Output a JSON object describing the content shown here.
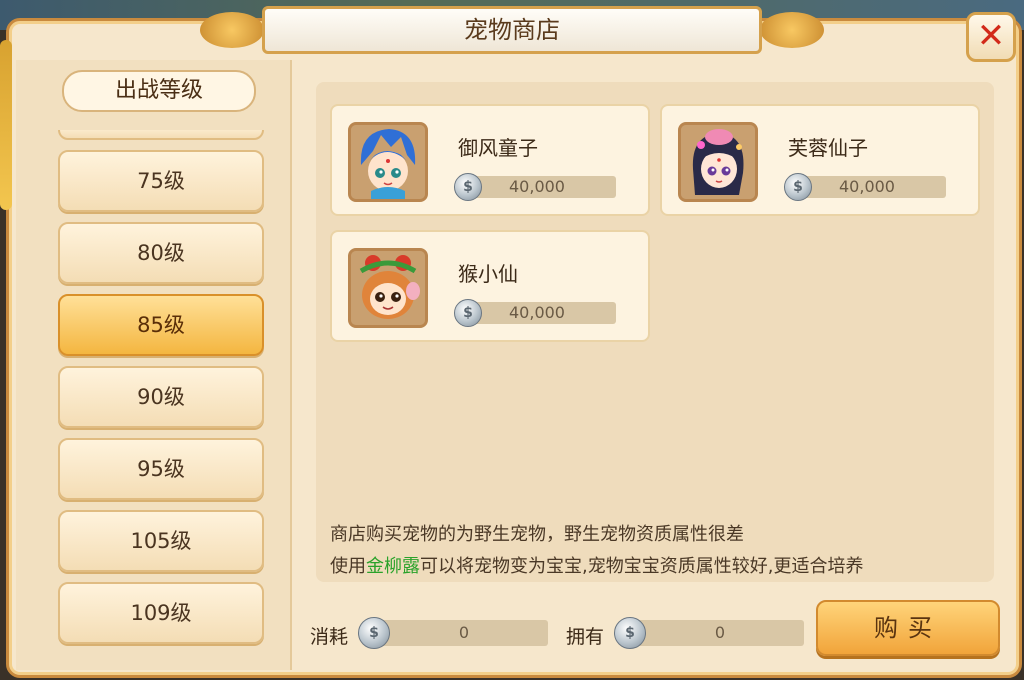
{
  "window": {
    "title": "宠物商店",
    "close_label": "✕"
  },
  "sidebar": {
    "header": "出战等级",
    "levels": [
      "75级",
      "80级",
      "85级",
      "90级",
      "95级",
      "105级",
      "109级"
    ],
    "selected_index": 2
  },
  "pets": [
    {
      "name": "御风童子",
      "price": "40,000",
      "portrait_icon": "blue-haired-boy-portrait"
    },
    {
      "name": "芙蓉仙子",
      "price": "40,000",
      "portrait_icon": "lotus-fairy-portrait"
    },
    {
      "name": "猴小仙",
      "price": "40,000",
      "portrait_icon": "monkey-portrait"
    }
  ],
  "description": {
    "line1": "商店购买宠物的为野生宠物，野生宠物资质属性很差",
    "line2_prefix": "使用",
    "line2_highlight": "金柳露",
    "line2_suffix": "可以将宠物变为宝宝,宠物宝宝资质属性较好,更适合培养"
  },
  "footer": {
    "cost_label": "消耗",
    "cost_value": "0",
    "owned_label": "拥有",
    "owned_value": "0",
    "buy_label": "购买"
  },
  "colors": {
    "accent": "#f1a43a",
    "highlight_text": "#2aa22a",
    "close": "#d22a1a"
  },
  "currency_icon": "silver-coin-icon"
}
